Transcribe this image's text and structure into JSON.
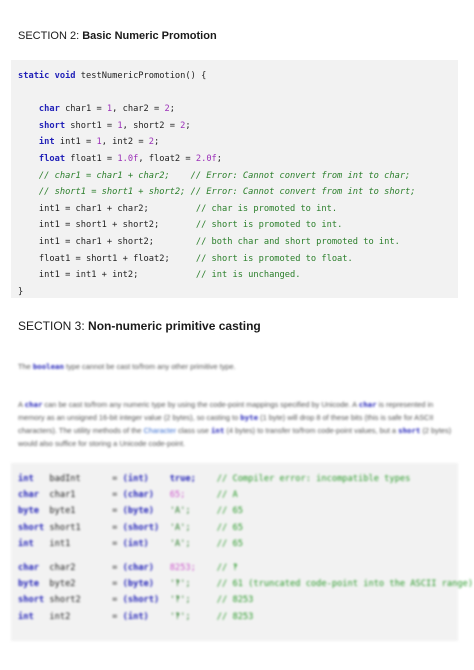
{
  "section2": {
    "number": "SECTION 2:",
    "title": "Basic Numeric Promotion"
  },
  "code1": {
    "signature": "static void testNumericPromotion() {",
    "decls": [
      {
        "type": "char",
        "text": "char1 = 1, char2 = 2;"
      },
      {
        "type": "short",
        "text": "short1 = 1, short2 = 2;"
      },
      {
        "type": "int",
        "text": "int1 = 1, int2 = 2;"
      },
      {
        "type": "float",
        "text": "float1 = 1.0f, float2 = 2.0f;"
      }
    ],
    "commented": [
      {
        "code": "// char1 = char1 + char2;",
        "comment": "// Error: Cannot convert from int to char;"
      },
      {
        "code": "// short1 = short1 + short2;",
        "comment": "// Error: Cannot convert from int to short;"
      }
    ],
    "statements": [
      {
        "code": "int1 = char1 + char2;",
        "comment": "// char is promoted to int."
      },
      {
        "code": "int1 = short1 + short2;",
        "comment": "// short is promoted to int."
      },
      {
        "code": "int1 = char1 + short2;",
        "comment": "// both char and short promoted to int."
      },
      {
        "code": "float1 = short1 + float2;",
        "comment": "// short is promoted to float."
      },
      {
        "code": "int1 = int1 + int2;",
        "comment": "// int is unchanged."
      }
    ],
    "closing": "}"
  },
  "section3": {
    "number": "SECTION 3:",
    "title": "Non-numeric primitive casting"
  },
  "para1": {
    "pre": "The",
    "code": "boolean",
    "post": "type cannot be cast to/from any other primitive type."
  },
  "para2": {
    "s1": "A",
    "c1": "char",
    "s2": "can be cast to/from any numeric type by using the code-point mappings specified by Unicode. A",
    "c2": "char",
    "s3": "is represented in memory as an unsigned 16-bit integer value (2 bytes), so casting to",
    "c3": "byte",
    "s4": "(1 byte) will drop 8 of these bits (this is safe for ASCII characters). The utility methods of the",
    "link": "Character",
    "s5": "class use",
    "c4": "int",
    "s6": "(4 bytes) to transfer to/from code-point values, but a",
    "c5": "short",
    "s7": "(2 bytes) would also suffice for storing a Unicode code-point."
  },
  "code2": {
    "rows": [
      {
        "type": "int",
        "name": "badInt",
        "cast": "= (int)",
        "val": "true;",
        "comment": "// Compiler error: incompatible types"
      },
      {
        "type": "char",
        "name": "char1",
        "cast": "= (char)",
        "val": "65;",
        "comment": "// A"
      },
      {
        "type": "byte",
        "name": "byte1",
        "cast": "= (byte)",
        "val": "'A';",
        "comment": "// 65"
      },
      {
        "type": "short",
        "name": "short1",
        "cast": "= (short)",
        "val": "'A';",
        "comment": "// 65"
      },
      {
        "type": "int",
        "name": "int1",
        "cast": "= (int)",
        "val": "'A';",
        "comment": "// 65"
      },
      {
        "type": "char",
        "name": "char2",
        "cast": "= (char)",
        "val": "8253;",
        "comment": "// ‽"
      },
      {
        "type": "byte",
        "name": "byte2",
        "cast": "= (byte)",
        "val": "'‽';",
        "comment": "// 61 (truncated code-point into the ASCII range)"
      },
      {
        "type": "short",
        "name": "short2",
        "cast": "= (short)",
        "val": "'‽';",
        "comment": "// 8253"
      },
      {
        "type": "int",
        "name": "int2",
        "cast": "= (int)",
        "val": "'‽';",
        "comment": "// 8253"
      }
    ]
  }
}
